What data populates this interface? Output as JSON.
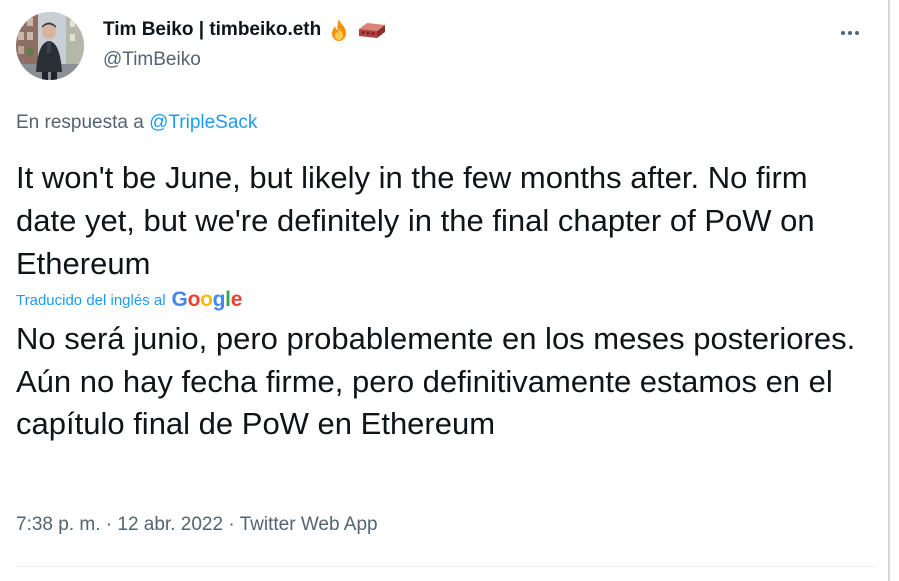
{
  "tweet": {
    "author": {
      "display_name": "Tim Beiko | timbeiko.eth",
      "handle": "@TimBeiko",
      "name_emojis": [
        "fire-icon",
        "brick-icon"
      ]
    },
    "more_icon": "more-options-icon",
    "reply_prefix": "En respuesta a",
    "reply_to": "@TripleSack",
    "text": "It won't be June, but likely in the few months after. No firm date yet, but we're definitely in the final chapter of PoW on Ethereum",
    "translation_label": "Traducido del inglés al",
    "translation_provider": {
      "letters": [
        "G",
        "o",
        "o",
        "g",
        "l",
        "e"
      ],
      "colors": [
        "#4285f4",
        "#ea4335",
        "#fbbc05",
        "#4285f4",
        "#34a853",
        "#ea4335"
      ]
    },
    "translation": "No será junio, pero probablemente en los meses posteriores. Aún no hay fecha firme, pero definitivamente estamos en el capítulo final de PoW en Ethereum",
    "time": "7:38 p. m.",
    "separator": "·",
    "date": "12 abr. 2022",
    "source": "Twitter Web App"
  },
  "colors": {
    "text": "#0f1419",
    "secondary": "#536471",
    "accent": "#1d9bf0",
    "divider": "#eff3f4"
  }
}
